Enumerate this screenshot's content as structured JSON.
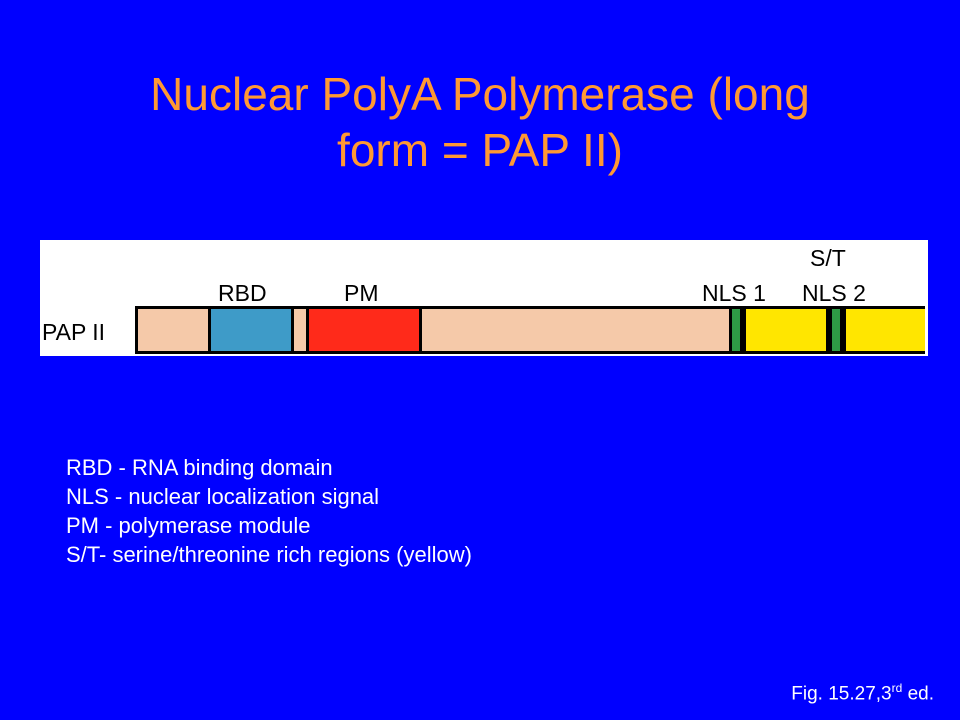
{
  "title": {
    "line1": "Nuclear PolyA Polymerase (long",
    "line2": "form = PAP II)"
  },
  "diagram": {
    "protein_label": "PAP II",
    "labels": {
      "rbd": "RBD",
      "pm": "PM",
      "nls1": "NLS 1",
      "st": "S/T",
      "nls2": "NLS 2"
    },
    "colors": {
      "background_peach": "#f5c9a9",
      "rbd_blue": "#3e9bc8",
      "pm_red": "#ff2a1a",
      "nls_green": "#2e9a45",
      "st_yellow": "#ffe600"
    }
  },
  "legend": {
    "line1": "RBD - RNA binding domain",
    "line2": "NLS - nuclear localization  signal",
    "line3": "PM - polymerase module",
    "line4": "S/T- serine/threonine rich regions (yellow)"
  },
  "citation": {
    "prefix": "Fig. 15.27,3",
    "superscript": "rd",
    "suffix": " ed."
  },
  "colors": {
    "slide_background": "#0000ff",
    "title_orange": "#ff9933",
    "body_text": "#ffffff"
  }
}
